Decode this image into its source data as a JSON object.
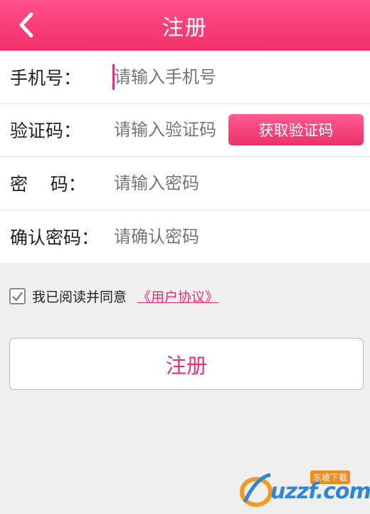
{
  "header": {
    "title": "注册"
  },
  "form": {
    "phone": {
      "label": "手机号：",
      "placeholder": "请输入手机号"
    },
    "code": {
      "label": "验证码：",
      "placeholder": "请输入验证码",
      "button": "获取验证码"
    },
    "password": {
      "label": "密    码：",
      "placeholder": "请输入密码"
    },
    "confirm": {
      "label": "确认密码：",
      "placeholder": "请确认密码"
    }
  },
  "agreement": {
    "checked": true,
    "text": "我已阅读并同意",
    "link": "《用户协议》"
  },
  "submit": {
    "label": "注册"
  },
  "watermark": {
    "brand": "uzzf.com",
    "sub": "东坡下载"
  },
  "colors": {
    "accent": "#e8336f",
    "header_top": "#ff4f8a",
    "header_bottom": "#f2306b"
  }
}
